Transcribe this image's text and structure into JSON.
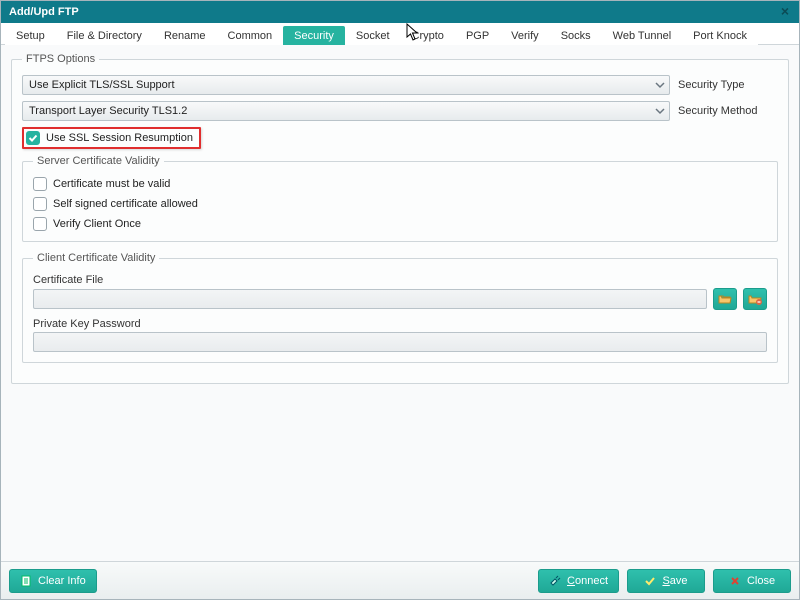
{
  "window": {
    "title": "Add/Upd FTP"
  },
  "tabs": [
    "Setup",
    "File & Directory",
    "Rename",
    "Common",
    "Security",
    "Socket",
    "Crypto",
    "PGP",
    "Verify",
    "Socks",
    "Web Tunnel",
    "Port Knock"
  ],
  "active_tab_index": 4,
  "ftps_options": {
    "legend": "FTPS Options",
    "security_type": {
      "value": "Use Explicit TLS/SSL Support",
      "label": "Security Type"
    },
    "security_method": {
      "value": "Transport Layer Security TLS1.2",
      "label": "Security Method"
    },
    "use_ssl_resumption": {
      "label": "Use SSL Session Resumption",
      "checked": true
    },
    "server_cert": {
      "legend": "Server Certificate Validity",
      "must_be_valid": {
        "label": "Certificate must be valid",
        "checked": false
      },
      "self_signed": {
        "label": "Self signed certificate allowed",
        "checked": false
      },
      "verify_once": {
        "label": "Verify Client Once",
        "checked": false
      }
    },
    "client_cert": {
      "legend": "Client Certificate Validity",
      "cert_file_label": "Certificate File",
      "cert_file_value": "",
      "pk_password_label": "Private Key Password",
      "pk_password_value": ""
    }
  },
  "footer": {
    "clear_info": "Clear Info",
    "connect": "onnect",
    "connect_u": "C",
    "save": "ave",
    "save_u": "S",
    "close": "Close"
  }
}
